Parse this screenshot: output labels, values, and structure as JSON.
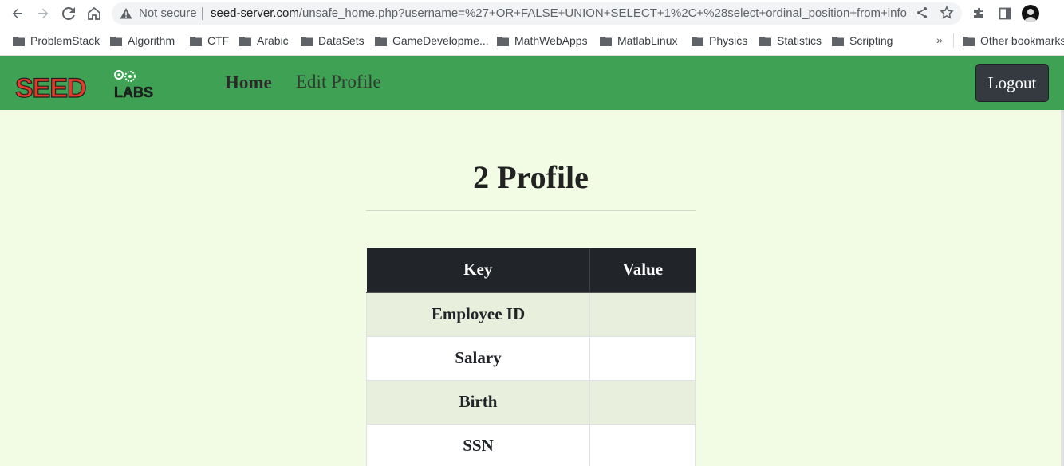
{
  "browser": {
    "security_label": "Not secure",
    "url_host": "seed-server.com",
    "url_path": "/unsafe_home.php?username=%27+OR+FALSE+UNION+SELECT+1%2C+%28select+ordinal_position+from+infor...",
    "bookmarks": [
      "ProblemStack",
      "Algorithm",
      "CTF",
      "Arabic",
      "DataSets",
      "GameDevelopme...",
      "MathWebApps",
      "MatlabLinux",
      "Physics",
      "Statistics",
      "Scripting"
    ],
    "overflow_label": "»",
    "other_bookmarks": "Other bookmarks"
  },
  "navbar": {
    "logo_text": "SEED LABS",
    "home_label": "Home",
    "edit_label": "Edit Profile",
    "logout_label": "Logout"
  },
  "profile": {
    "title": "2 Profile",
    "headers": {
      "key": "Key",
      "value": "Value"
    },
    "rows": [
      {
        "key": "Employee ID",
        "value": ""
      },
      {
        "key": "Salary",
        "value": ""
      },
      {
        "key": "Birth",
        "value": ""
      },
      {
        "key": "SSN",
        "value": ""
      }
    ]
  }
}
